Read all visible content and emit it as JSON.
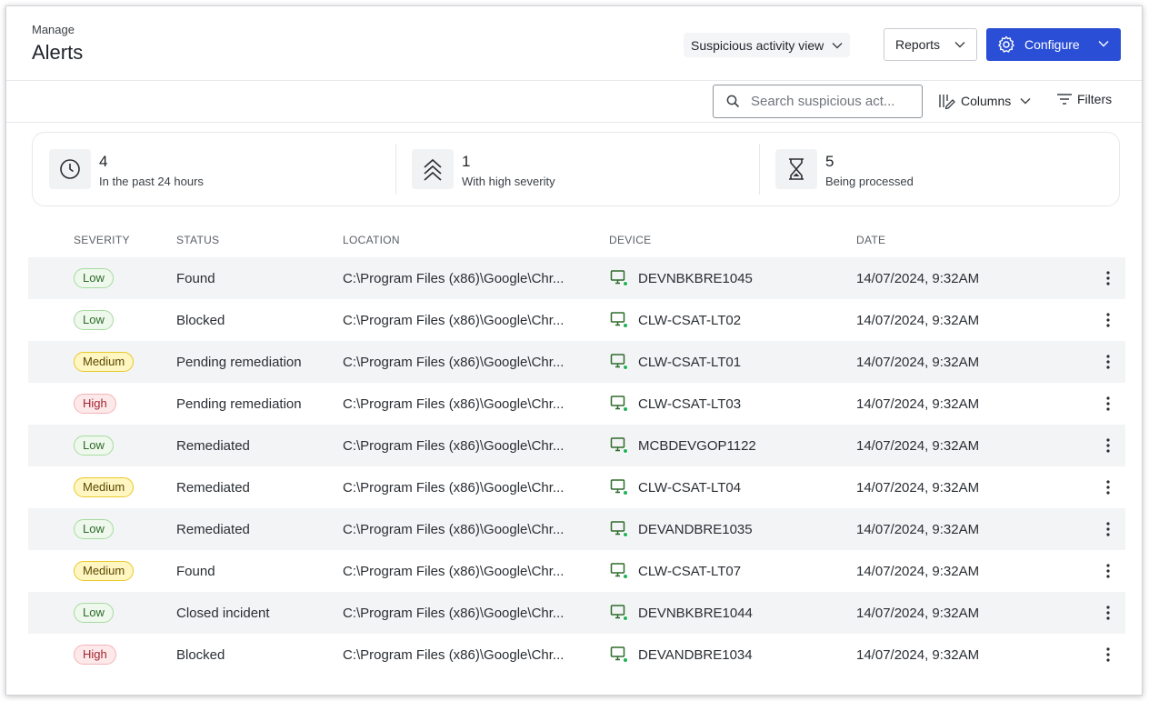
{
  "header": {
    "breadcrumb": "Manage",
    "title": "Alerts",
    "view_select": "Suspicious activity view",
    "reports_label": "Reports",
    "configure_label": "Configure"
  },
  "toolbar": {
    "search_placeholder": "Search suspicious act...",
    "columns_label": "Columns",
    "filters_label": "Filters"
  },
  "stats": [
    {
      "value": "4",
      "label": "In the past 24 hours",
      "icon": "clock-icon"
    },
    {
      "value": "1",
      "label": "With high severity",
      "icon": "double-chevron-up-icon"
    },
    {
      "value": "5",
      "label": "Being processed",
      "icon": "hourglass-icon"
    }
  ],
  "table": {
    "columns": [
      "SEVERITY",
      "STATUS",
      "LOCATION",
      "DEVICE",
      "DATE"
    ],
    "rows": [
      {
        "severity": "Low",
        "status": "Found",
        "location": "C:\\Program Files (x86)\\Google\\Chr...",
        "device": "DEVNBKBRE1045",
        "date": "14/07/2024, 9:32AM"
      },
      {
        "severity": "Low",
        "status": "Blocked",
        "location": "C:\\Program Files (x86)\\Google\\Chr...",
        "device": "CLW-CSAT-LT02",
        "date": "14/07/2024, 9:32AM"
      },
      {
        "severity": "Medium",
        "status": "Pending remediation",
        "location": "C:\\Program Files (x86)\\Google\\Chr...",
        "device": "CLW-CSAT-LT01",
        "date": "14/07/2024, 9:32AM"
      },
      {
        "severity": "High",
        "status": "Pending remediation",
        "location": "C:\\Program Files (x86)\\Google\\Chr...",
        "device": "CLW-CSAT-LT03",
        "date": "14/07/2024, 9:32AM"
      },
      {
        "severity": "Low",
        "status": "Remediated",
        "location": "C:\\Program Files (x86)\\Google\\Chr...",
        "device": "MCBDEVGOP1122",
        "date": "14/07/2024, 9:32AM"
      },
      {
        "severity": "Medium",
        "status": "Remediated",
        "location": "C:\\Program Files (x86)\\Google\\Chr...",
        "device": "CLW-CSAT-LT04",
        "date": "14/07/2024, 9:32AM"
      },
      {
        "severity": "Low",
        "status": "Remediated",
        "location": "C:\\Program Files (x86)\\Google\\Chr...",
        "device": "DEVANDBRE1035",
        "date": "14/07/2024, 9:32AM"
      },
      {
        "severity": "Medium",
        "status": "Found",
        "location": "C:\\Program Files (x86)\\Google\\Chr...",
        "device": "CLW-CSAT-LT07",
        "date": "14/07/2024, 9:32AM"
      },
      {
        "severity": "Low",
        "status": "Closed incident",
        "location": "C:\\Program Files (x86)\\Google\\Chr...",
        "device": "DEVNBKBRE1044",
        "date": "14/07/2024, 9:32AM"
      },
      {
        "severity": "High",
        "status": "Blocked",
        "location": "C:\\Program Files (x86)\\Google\\Chr...",
        "device": "DEVANDBRE1034",
        "date": "14/07/2024, 9:32AM"
      }
    ]
  },
  "colors": {
    "primary": "#2a4fd6",
    "low": "#a7dba0",
    "medium": "#e8c92a",
    "high": "#f3b4b8",
    "device_online": "#1fb356"
  }
}
